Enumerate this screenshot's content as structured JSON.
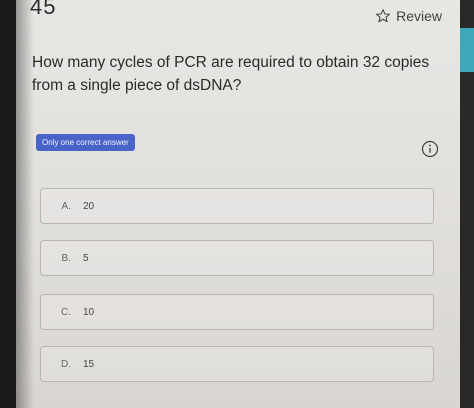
{
  "header": {
    "question_number": "45",
    "review_label": "Review"
  },
  "question": {
    "text": "How many cycles of PCR are required to obtain 32 copies from a single piece of dsDNA?"
  },
  "answer_type": "Only one correct answer",
  "icons": {
    "review": "star-outline-icon",
    "info": "info-circle-icon"
  },
  "options": [
    {
      "letter": "A.",
      "text": "20"
    },
    {
      "letter": "B.",
      "text": "5"
    },
    {
      "letter": "C.",
      "text": "10"
    },
    {
      "letter": "D.",
      "text": "15"
    }
  ],
  "colors": {
    "accent": "#4a63c8",
    "screen_bg": "#e6e4e1",
    "text": "#2a2a2a"
  }
}
